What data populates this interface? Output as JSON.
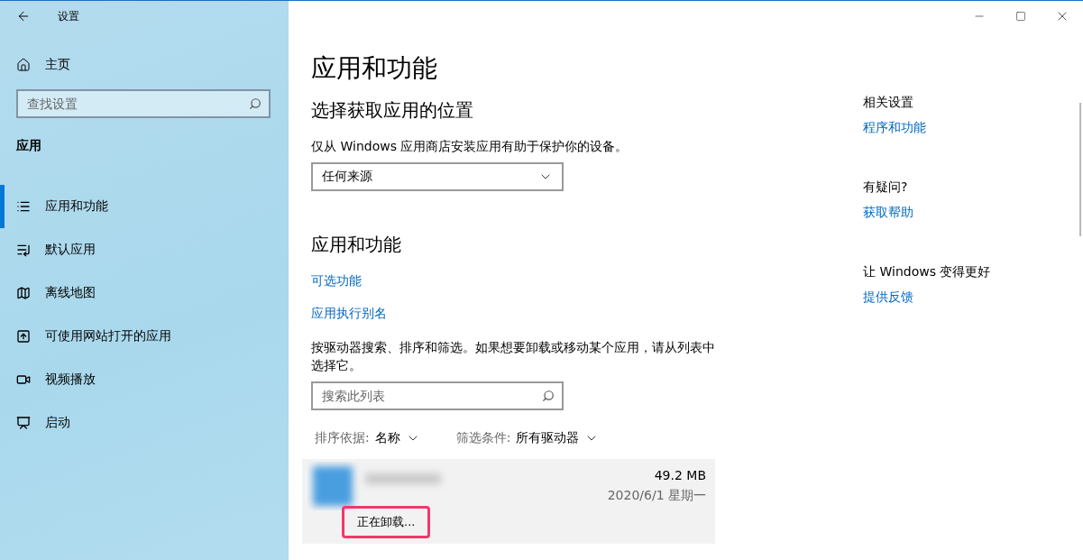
{
  "window": {
    "title": "设置"
  },
  "sidebar": {
    "home": "主页",
    "search": {
      "placeholder": "查找设置"
    },
    "section": "应用",
    "items": [
      {
        "label": "应用和功能",
        "kind": "list",
        "selected": true
      },
      {
        "label": "默认应用",
        "kind": "defaults",
        "selected": false
      },
      {
        "label": "离线地图",
        "kind": "map",
        "selected": false
      },
      {
        "label": "可使用网站打开的应用",
        "kind": "web",
        "selected": false
      },
      {
        "label": "视频播放",
        "kind": "video",
        "selected": false
      },
      {
        "label": "启动",
        "kind": "startup",
        "selected": false
      }
    ]
  },
  "main": {
    "title": "应用和功能",
    "source": {
      "heading": "选择获取应用的位置",
      "description": "仅从 Windows 应用商店安装应用有助于保护你的设备。",
      "dropdown": "任何来源"
    },
    "apps": {
      "heading": "应用和功能",
      "links": [
        "可选功能",
        "应用执行别名"
      ],
      "description": "按驱动器搜索、排序和筛选。如果想要卸载或移动某个应用，请从列表中选择它。",
      "search": {
        "placeholder": "搜索此列表"
      },
      "sort": {
        "label": "排序依据:",
        "value": "名称"
      },
      "filter": {
        "label": "筛选条件:",
        "value": "所有驱动器"
      },
      "list": [
        {
          "size": "49.2 MB",
          "date": "2020/6/1 星期一",
          "status": "正在卸载...",
          "highlighted": true
        }
      ]
    }
  },
  "related": [
    {
      "heading": "相关设置",
      "link": "程序和功能"
    },
    {
      "heading": "有疑问?",
      "link": "获取帮助"
    },
    {
      "heading": "让 Windows 变得更好",
      "link": "提供反馈"
    }
  ]
}
